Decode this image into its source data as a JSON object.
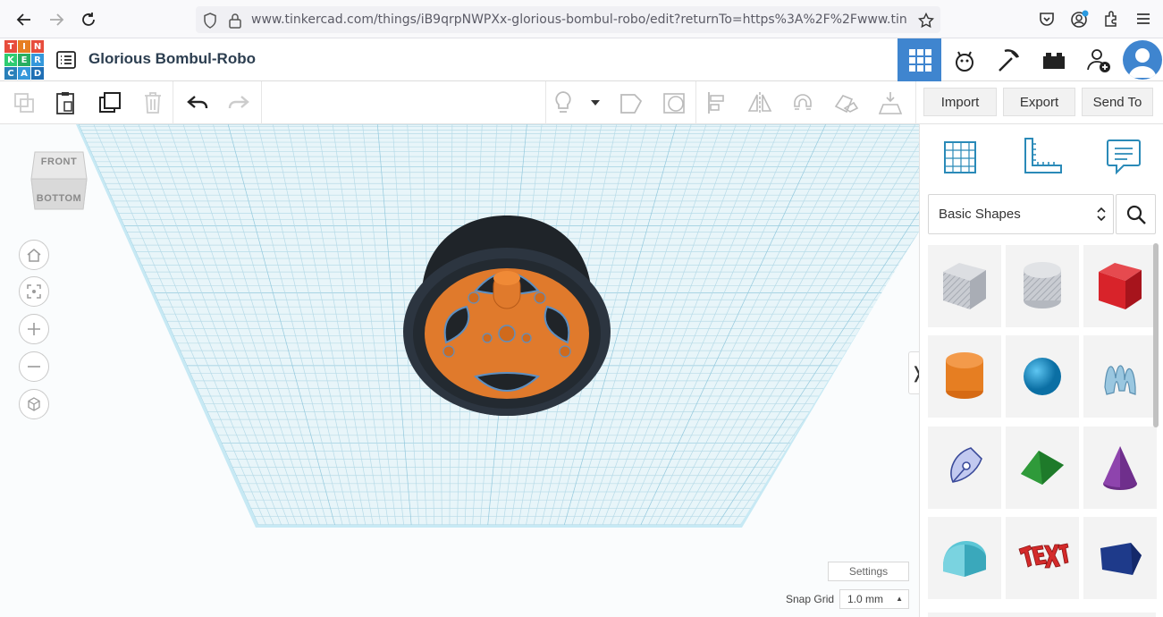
{
  "browser": {
    "url": "www.tinkercad.com/things/iB9qrpNWPXx-glorious-bombul-robo/edit?returnTo=https%3A%2F%2Fwww.tin"
  },
  "app": {
    "logo_letters": [
      "T",
      "I",
      "N",
      "K",
      "E",
      "R",
      "C",
      "A",
      "D"
    ],
    "design_title": "Glorious Bombul-Robo"
  },
  "toolbar": {
    "import_label": "Import",
    "export_label": "Export",
    "send_to_label": "Send To"
  },
  "viewcube": {
    "front_label": "FRONT",
    "bottom_label": "BOTTOM"
  },
  "canvas": {
    "settings_label": "Settings",
    "snap_grid_label": "Snap Grid",
    "snap_grid_value": "1.0 mm"
  },
  "panel": {
    "category": "Basic Shapes",
    "shapes": [
      "box-hole",
      "cylinder-hole",
      "box",
      "cylinder",
      "sphere",
      "scribble",
      "shape-generator",
      "roof",
      "cone",
      "round-roof",
      "text",
      "polygon"
    ]
  },
  "colors": {
    "accent": "#3f85cf",
    "wheel_orange": "#e0782a",
    "tire_dark": "#22262b"
  }
}
